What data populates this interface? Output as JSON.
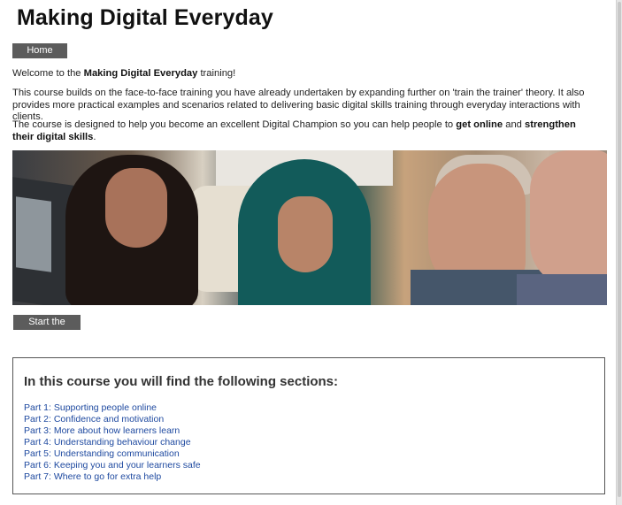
{
  "header": {
    "title": "Making Digital Everyday"
  },
  "nav": {
    "home_label": "Home"
  },
  "intro": {
    "p1_before": "Welcome to the ",
    "p1_bold": "Making Digital Everyday",
    "p1_after": " training!",
    "p2": "This course builds on the face-to-face training you have already undertaken by expanding further on 'train the trainer' theory. It also provides more practical examples and scenarios related to delivering basic digital skills training through everyday interactions with clients.",
    "p3_before": "The course is designed to help you become an excellent Digital Champion so you can help people to ",
    "p3_bold1": "get online",
    "p3_mid": " and ",
    "p3_bold2": "strengthen their digital skills",
    "p3_after": "."
  },
  "start": {
    "label": "Start the course"
  },
  "sections": {
    "heading": "In this course you will find the following sections:",
    "items": [
      "Part 1: Supporting people online",
      "Part 2: Confidence and motivation",
      "Part 3: More about how learners learn",
      "Part 4: Understanding behaviour change",
      "Part 5: Understanding communication",
      "Part 6: Keeping you and your learners safe",
      "Part 7: Where to go for extra help"
    ]
  },
  "colors": {
    "button_bg": "#5c5c5c",
    "link": "#1f4aa0"
  }
}
